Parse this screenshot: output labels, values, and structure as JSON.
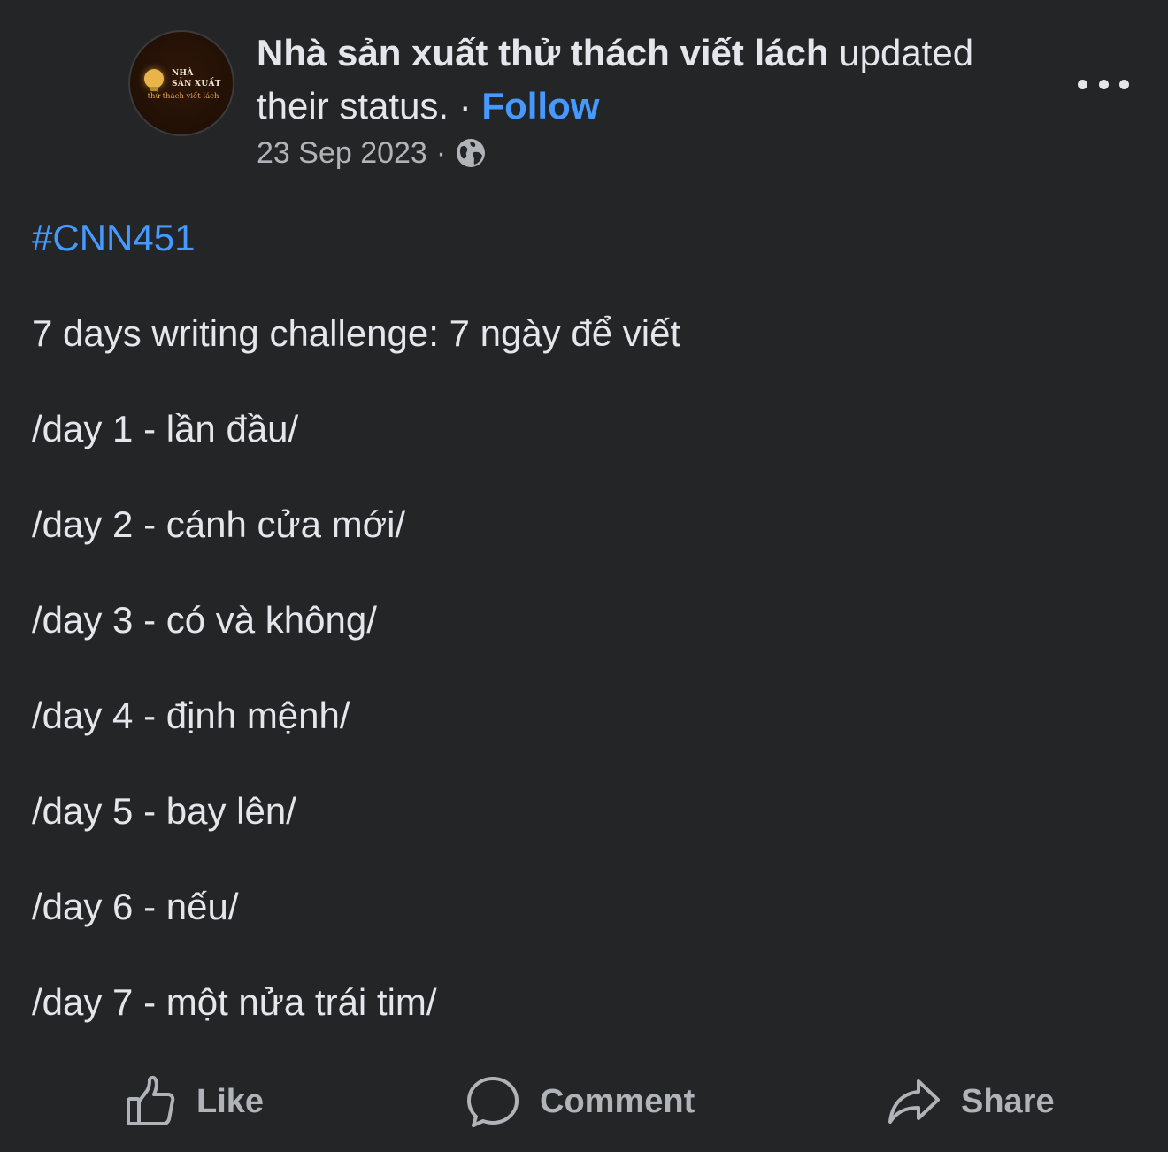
{
  "post": {
    "author": "Nhà sản xuất thử thách viết lách",
    "action_text": " updated their status. · ",
    "follow_label": "Follow",
    "date": "23 Sep 2023",
    "date_separator": "·",
    "privacy_icon": "globe-icon",
    "more_icon": "more-options-icon",
    "avatar": {
      "line1": "NHÀ",
      "line2": "SẢN XUẤT",
      "line3": "thử thách viết lách"
    }
  },
  "content": {
    "hashtag": "#CNN451",
    "lines": [
      "7 days writing challenge: 7 ngày để viết",
      "/day 1 - lần đầu/",
      "/day 2 - cánh cửa mới/",
      "/day 3 - có và không/",
      "/day 4 - định mệnh/",
      "/day 5 - bay lên/",
      "/day 6 - nếu/",
      "/day 7 - một nửa trái tim/"
    ]
  },
  "actions": {
    "like_label": "Like",
    "comment_label": "Comment",
    "share_label": "Share"
  },
  "colors": {
    "background": "#242526",
    "text": "#e4e6eb",
    "secondary_text": "#b0b3b8",
    "link": "#4599ff"
  }
}
